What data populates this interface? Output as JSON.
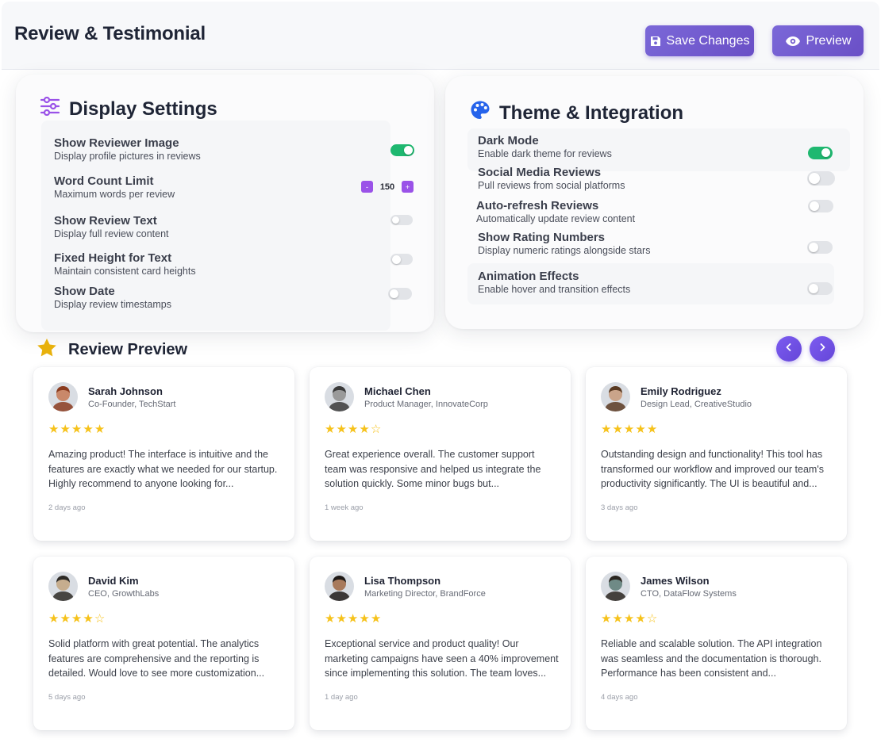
{
  "header": {
    "title": "Review & Testimonial",
    "save_label": "Save Changes",
    "preview_label": "Preview"
  },
  "display_settings": {
    "title": "Display Settings",
    "items": [
      {
        "label": "Show Reviewer Image",
        "desc": "Display profile pictures in reviews",
        "control": "toggle",
        "on": true
      },
      {
        "label": "Word Count Limit",
        "desc": "Maximum words per review",
        "control": "stepper",
        "value": "150",
        "minus": "-",
        "plus": "+"
      },
      {
        "label": "Show Review Text",
        "desc": "Display full review content",
        "control": "toggle",
        "on": false
      },
      {
        "label": "Fixed Height for Text",
        "desc": "Maintain consistent card heights",
        "control": "toggle",
        "on": false
      },
      {
        "label": "Show Date",
        "desc": "Display review timestamps",
        "control": "toggle",
        "on": false
      }
    ]
  },
  "theme_integration": {
    "title": "Theme & Integration",
    "items": [
      {
        "label": "Dark Mode",
        "desc": "Enable dark theme for reviews",
        "on": true
      },
      {
        "label": "Social Media Reviews",
        "desc": "Pull reviews from social platforms",
        "on": false
      },
      {
        "label": "Auto-refresh Reviews",
        "desc": "Automatically update review content",
        "on": false
      },
      {
        "label": "Show Rating Numbers",
        "desc": "Display numeric ratings alongside stars",
        "on": false
      },
      {
        "label": "Animation Effects",
        "desc": "Enable hover and transition effects",
        "on": false
      }
    ]
  },
  "review_preview": {
    "title": "Review Preview",
    "prev_icon": "chevron-left-icon",
    "next_icon": "chevron-right-icon",
    "reviews": [
      {
        "name": "Sarah Johnson",
        "role": "Co-Founder, TechStart",
        "rating": 5,
        "text": "Amazing product! The interface is intuitive and the features are exactly what we needed for our startup. Highly recommend to anyone looking for...",
        "date": "2 days ago",
        "avatar_color": "#c9886a",
        "hair": "#8a3b1e"
      },
      {
        "name": "Michael Chen",
        "role": "Product Manager, InnovateCorp",
        "rating": 4,
        "text": "Great experience overall. The customer support team was responsive and helped us integrate the solution quickly. Some minor bugs but...",
        "date": "1 week ago",
        "avatar_color": "#9a9a9a",
        "hair": "#3a3a3a"
      },
      {
        "name": "Emily Rodriguez",
        "role": "Design Lead, CreativeStudio",
        "rating": 5,
        "text": "Outstanding design and functionality! This tool has transformed our workflow and improved our team's productivity significantly. The UI is beautiful and...",
        "date": "3 days ago",
        "avatar_color": "#caa48a",
        "hair": "#5a3a22"
      },
      {
        "name": "David Kim",
        "role": "CEO, GrowthLabs",
        "rating": 4,
        "text": "Solid platform with great potential. The analytics features are comprehensive and the reporting is detailed. Would love to see more customization...",
        "date": "5 days ago",
        "avatar_color": "#c6ad8e",
        "hair": "#2d2a26"
      },
      {
        "name": "Lisa Thompson",
        "role": "Marketing Director, BrandForce",
        "rating": 5,
        "text": "Exceptional service and product quality! Our marketing campaigns have seen a 40% improvement since implementing this solution. The team loves...",
        "date": "1 day ago",
        "avatar_color": "#a87a5c",
        "hair": "#1f1a18"
      },
      {
        "name": "James Wilson",
        "role": "CTO, DataFlow Systems",
        "rating": 4,
        "text": "Reliable and scalable solution. The API integration was seamless and the documentation is thorough. Performance has been consistent and...",
        "date": "4 days ago",
        "avatar_color": "#6f8a86",
        "hair": "#2a2620"
      }
    ]
  },
  "colors": {
    "accent": "#7b68d8",
    "toggle_on": "#1fb870",
    "toggle_off": "#e2e4e8",
    "star": "#f6c21b",
    "settings_icon": "#9a52e8",
    "palette_icon": "#2563eb",
    "star_icon": "#e8b10c"
  }
}
